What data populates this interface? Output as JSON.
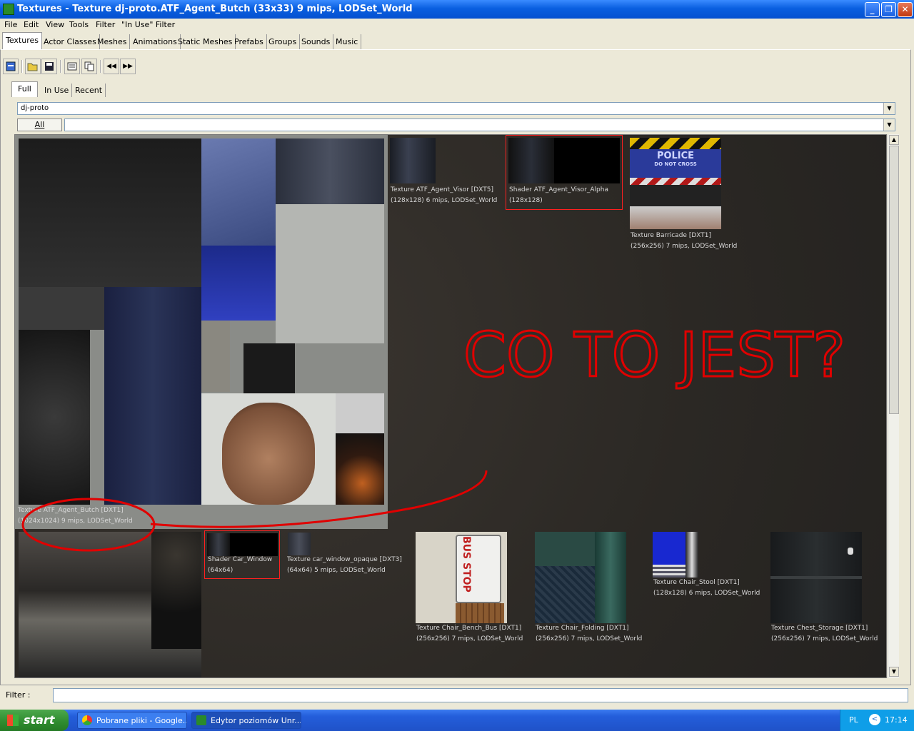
{
  "window": {
    "title": "Textures - Texture dj-proto.ATF_Agent_Butch (33x33) 9 mips, LODSet_World",
    "minimize": "_",
    "maximize": "❐",
    "close": "✕"
  },
  "menu": [
    "File",
    "Edit",
    "View",
    "Tools",
    "Filter",
    "\"In Use\" Filter"
  ],
  "main_tabs": [
    "Textures",
    "Actor Classes",
    "Meshes",
    "Animations",
    "Static Meshes",
    "Prefabs",
    "Groups",
    "Sounds",
    "Music"
  ],
  "sub_tabs": [
    "Full",
    "In Use",
    "Recent"
  ],
  "package": {
    "value": "dj-proto",
    "all_label": "All",
    "group_value": ""
  },
  "toolbar": {
    "icons": [
      "dock-icon",
      "open-icon",
      "save-icon",
      "properties-icon",
      "copy-icon",
      "prev-icon",
      "next-icon"
    ],
    "prev_glyph": "◀◀",
    "next_glyph": "▶▶"
  },
  "textures": [
    {
      "name": "Texture ATF_Agent_Butch [DXT1]",
      "info": "(1024x1024) 9 mips, LODSet_World"
    },
    {
      "name": "Texture ATF_Agent_Visor [DXT5]",
      "info": "(128x128) 6 mips, LODSet_World"
    },
    {
      "name": "Shader ATF_Agent_Visor_Alpha",
      "info": "(128x128)"
    },
    {
      "name": "Texture Barricade [DXT1]",
      "info": "(256x256) 7 mips, LODSet_World"
    },
    {
      "name": "Shader Car_Window",
      "info": "(64x64)"
    },
    {
      "name": "Texture car_window_opaque [DXT3]",
      "info": "(64x64) 5 mips, LODSet_World"
    },
    {
      "name": "Texture Chair_Bench_Bus [DXT1]",
      "info": "(256x256) 7 mips, LODSet_World"
    },
    {
      "name": "Texture Chair_Folding [DXT1]",
      "info": "(256x256) 7 mips, LODSet_World"
    },
    {
      "name": "Texture Chair_Stool [DXT1]",
      "info": "(128x128) 6 mips, LODSet_World"
    },
    {
      "name": "Texture Chest_Storage [DXT1]",
      "info": "(256x256) 7 mips, LODSet_World"
    }
  ],
  "barricade_text": {
    "line1": "POLICE",
    "line2": "DO NOT CROSS"
  },
  "bus_stop_text": "BUS STOP",
  "annotation": {
    "text": "CO TO JEST?",
    "color": "#e00000"
  },
  "filter": {
    "label": "Filter :",
    "value": ""
  },
  "taskbar": {
    "start": "start",
    "tasks": [
      "Pobrane pliki - Google...",
      "Edytor poziomów Unr..."
    ],
    "lang": "PL",
    "time": "17:14"
  },
  "colors": {
    "selection": "#ff2020",
    "titlebar": "#0a5fe0",
    "taskbar": "#245edb"
  }
}
